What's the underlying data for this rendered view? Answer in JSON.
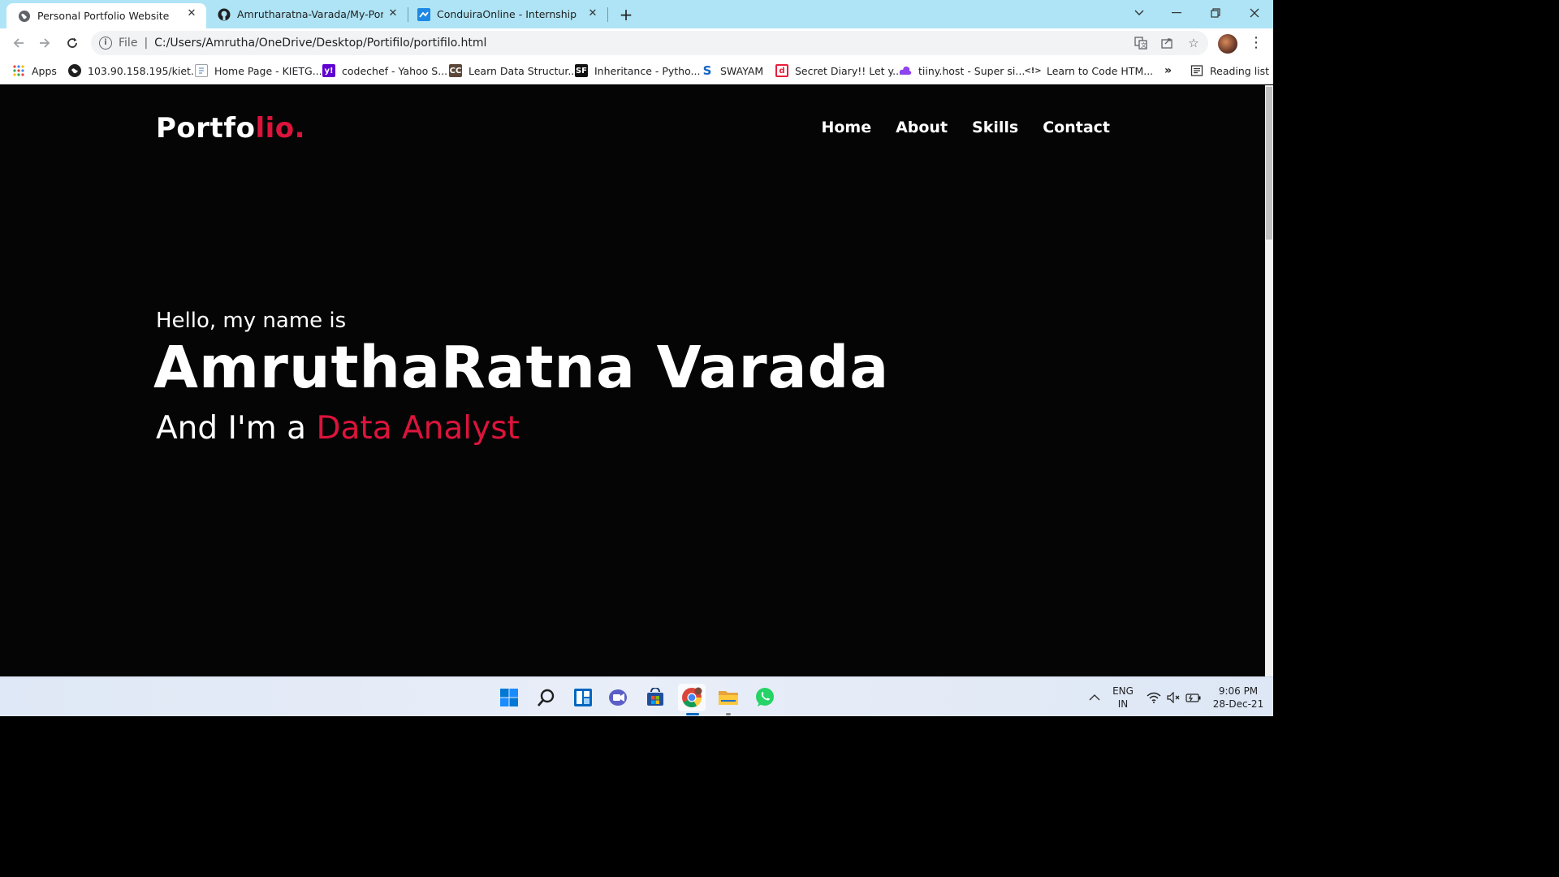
{
  "browser": {
    "tabs": [
      {
        "title": "Personal Portfolio Website",
        "icon": "globe-icon"
      },
      {
        "title": "Amrutharatna-Varada/My-Portfoli",
        "icon": "github-icon"
      },
      {
        "title": "ConduiraOnline - Internship",
        "icon": "conduira-icon"
      }
    ],
    "address": {
      "scheme_label": "File",
      "url": "C:/Users/Amrutha/OneDrive/Desktop/Portifilo/portifilo.html"
    },
    "bookmarks": [
      {
        "label": "Apps",
        "icon": "apps-grid-icon"
      },
      {
        "label": "103.90.158.195/kiet...",
        "icon": "globe-icon"
      },
      {
        "label": "Home Page - KIETG...",
        "icon": "page-icon"
      },
      {
        "label": "codechef - Yahoo S...",
        "icon": "yahoo-icon"
      },
      {
        "label": "Learn Data Structur...",
        "icon": "cc-icon"
      },
      {
        "label": "Inheritance - Pytho...",
        "icon": "sf-icon"
      },
      {
        "label": "SWAYAM",
        "icon": "swayam-icon"
      },
      {
        "label": "Secret Diary!! Let y...",
        "icon": "diary-icon"
      },
      {
        "label": "tiiny.host - Super si...",
        "icon": "tiiny-icon"
      },
      {
        "label": "Learn to Code HTM...",
        "icon": "code-icon"
      }
    ],
    "overflow_label": "»",
    "reading_list_label": "Reading list"
  },
  "site": {
    "logo_main": "Portfo",
    "logo_accent": "lio.",
    "nav": [
      "Home",
      "About",
      "Skills",
      "Contact"
    ],
    "hero": {
      "greeting": "Hello, my name is",
      "name": "AmruthaRatna Varada",
      "role_prefix": "And I'm a",
      "role": "Data Analyst"
    },
    "accent_color": "#dc143c"
  },
  "taskbar": {
    "apps": [
      "start-icon",
      "search-icon",
      "widgets-icon",
      "chat-icon",
      "store-icon",
      "chrome-icon",
      "file-explorer-icon",
      "whatsapp-icon"
    ],
    "language": {
      "line1": "ENG",
      "line2": "IN"
    },
    "time": "9:06 PM",
    "date": "28-Dec-21"
  }
}
